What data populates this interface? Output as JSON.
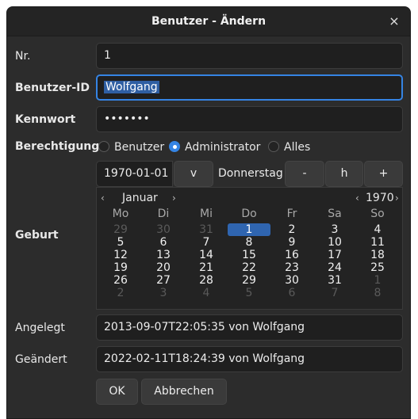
{
  "window": {
    "title": "Benutzer - Ändern",
    "close_glyph": "×"
  },
  "fields": {
    "nr": {
      "label": "Nr.",
      "value": "1"
    },
    "benutzer_id": {
      "label": "Benutzer-ID",
      "value": "Wolfgang"
    },
    "kennwort": {
      "label": "Kennwort",
      "value": "•••••••"
    },
    "berechtigung": {
      "label": "Berechtigung",
      "options": [
        "Benutzer",
        "Administrator",
        "Alles"
      ],
      "selected": "Administrator"
    },
    "geburt": {
      "label": "Geburt",
      "date": "1970-01-01",
      "dropdown_button": "v",
      "weekday": "Donnerstag",
      "minus_button": "-",
      "today_button": "h",
      "plus_button": "+"
    },
    "angelegt": {
      "label": "Angelegt",
      "value": "2013-09-07T22:05:35 von Wolfgang"
    },
    "geaendert": {
      "label": "Geändert",
      "value": "2022-02-11T18:24:39 von Wolfgang"
    }
  },
  "calendar": {
    "month": "Januar",
    "year": "1970",
    "prev": "‹",
    "next": "›",
    "weekdays": [
      "Mo",
      "Di",
      "Mi",
      "Do",
      "Fr",
      "Sa",
      "So"
    ],
    "weeks": [
      [
        {
          "d": "29",
          "dim": true
        },
        {
          "d": "30",
          "dim": true
        },
        {
          "d": "31",
          "dim": true
        },
        {
          "d": "1",
          "sel": true
        },
        {
          "d": "2"
        },
        {
          "d": "3"
        },
        {
          "d": "4"
        }
      ],
      [
        {
          "d": "5"
        },
        {
          "d": "6"
        },
        {
          "d": "7"
        },
        {
          "d": "8"
        },
        {
          "d": "9"
        },
        {
          "d": "10"
        },
        {
          "d": "11"
        }
      ],
      [
        {
          "d": "12"
        },
        {
          "d": "13"
        },
        {
          "d": "14"
        },
        {
          "d": "15"
        },
        {
          "d": "16"
        },
        {
          "d": "17"
        },
        {
          "d": "18"
        }
      ],
      [
        {
          "d": "19"
        },
        {
          "d": "20"
        },
        {
          "d": "21"
        },
        {
          "d": "22"
        },
        {
          "d": "23"
        },
        {
          "d": "24"
        },
        {
          "d": "25"
        }
      ],
      [
        {
          "d": "26"
        },
        {
          "d": "27"
        },
        {
          "d": "28"
        },
        {
          "d": "29"
        },
        {
          "d": "30"
        },
        {
          "d": "31"
        },
        {
          "d": "1",
          "dim": true
        }
      ],
      [
        {
          "d": "2",
          "dim": true
        },
        {
          "d": "3",
          "dim": true
        },
        {
          "d": "4",
          "dim": true
        },
        {
          "d": "5",
          "dim": true
        },
        {
          "d": "6",
          "dim": true
        },
        {
          "d": "7",
          "dim": true
        },
        {
          "d": "8",
          "dim": true
        }
      ]
    ]
  },
  "buttons": {
    "ok": "OK",
    "cancel": "Abbrechen"
  },
  "colors": {
    "accent": "#3584e4",
    "background": "#2c2c2c",
    "field": "#1f1f1f"
  }
}
